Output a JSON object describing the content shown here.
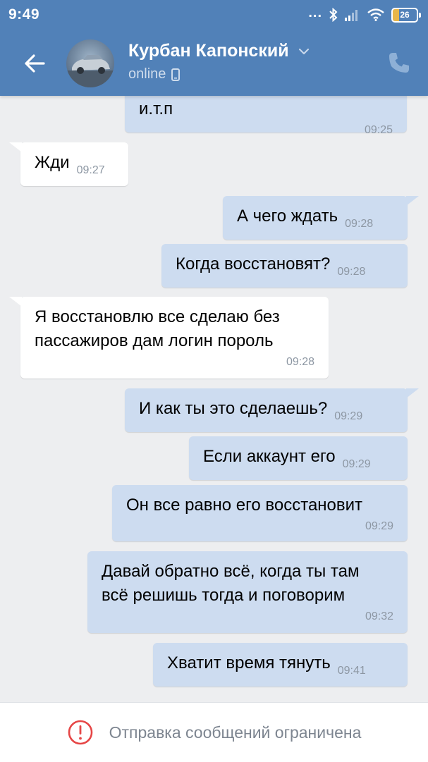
{
  "status_bar": {
    "time": "9:49",
    "dots": "...",
    "battery": "26",
    "battery_level": 0.26,
    "icons": [
      "bluetooth-icon",
      "signal-icon",
      "wifi-icon",
      "battery-icon"
    ]
  },
  "header": {
    "contact_name": "Курбан Капонский",
    "status": "online",
    "icons": [
      "back-arrow-icon",
      "chevron-down-icon",
      "mobile-device-icon",
      "phone-icon"
    ]
  },
  "messages": [
    {
      "direction": "out",
      "text": "и.т.п",
      "time": "09:25"
    },
    {
      "direction": "in",
      "text": "Жди",
      "time": "09:27"
    },
    {
      "direction": "out",
      "text": "А чего ждать",
      "time": "09:28"
    },
    {
      "direction": "out",
      "text": "Когда восстановят?",
      "time": "09:28"
    },
    {
      "direction": "in",
      "text": "Я восстановлю все сделаю без\nпассажиров дам логин пороль",
      "time": "09:28"
    },
    {
      "direction": "out",
      "text": "И как ты это сделаешь?",
      "time": "09:29"
    },
    {
      "direction": "out",
      "text": "Если аккаунт его",
      "time": "09:29"
    },
    {
      "direction": "out",
      "text": "Он все равно его восстановит",
      "time": "09:29"
    },
    {
      "direction": "out",
      "text": "Давай обратно всё, когда ты там\nвсё решишь тогда и поговорим",
      "time": "09:32"
    },
    {
      "direction": "out",
      "text": "Хватит время тянуть",
      "time": "09:41"
    }
  ],
  "footer": {
    "notice": "Отправка сообщений ограничена",
    "icon": "alert-circle-icon",
    "alert_color": "#e64646"
  },
  "colors": {
    "header": "#5181b8",
    "background": "#edeef0",
    "outgoing_bubble": "#cddcf0",
    "incoming_bubble": "#ffffff"
  }
}
